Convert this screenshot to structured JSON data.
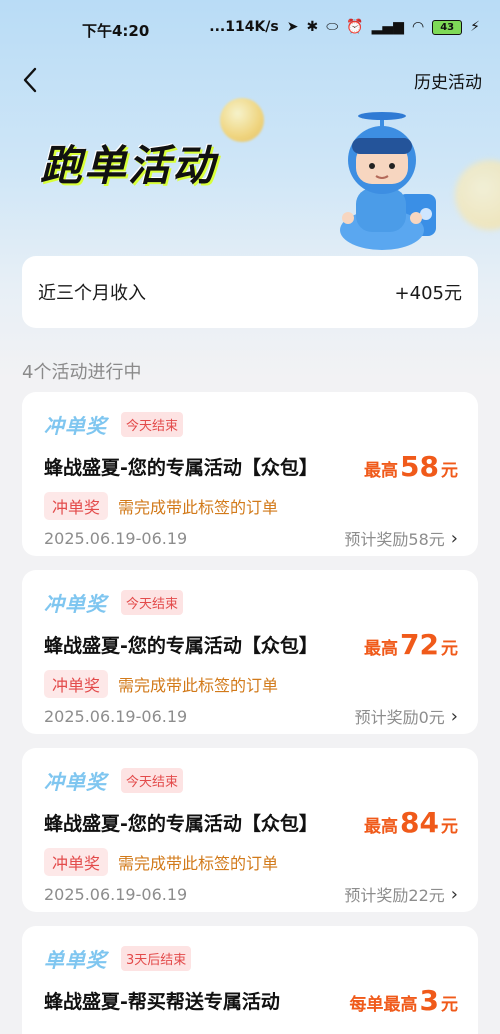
{
  "status": {
    "time": "下午4:20",
    "network": "...114K/s",
    "battery": "43"
  },
  "nav": {
    "back_icon": "chevron-left-icon",
    "history_label": "历史活动"
  },
  "hero": {
    "title": "跑单活动"
  },
  "income": {
    "label": "近三个月收入",
    "value": "+405元"
  },
  "section": {
    "title": "4个活动进行中"
  },
  "activities": [
    {
      "type_label": "冲单奖",
      "deadline": "今天结束",
      "title": "蜂战盛夏-您的专属活动【众包】",
      "reward_prefix": "最高",
      "reward_value": "58",
      "reward_unit": "元",
      "tag": "冲单奖",
      "requirement": "需完成带此标签的订单",
      "date_range": "2025.06.19-06.19",
      "estimate": "预计奖励58元"
    },
    {
      "type_label": "冲单奖",
      "deadline": "今天结束",
      "title": "蜂战盛夏-您的专属活动【众包】",
      "reward_prefix": "最高",
      "reward_value": "72",
      "reward_unit": "元",
      "tag": "冲单奖",
      "requirement": "需完成带此标签的订单",
      "date_range": "2025.06.19-06.19",
      "estimate": "预计奖励0元"
    },
    {
      "type_label": "冲单奖",
      "deadline": "今天结束",
      "title": "蜂战盛夏-您的专属活动【众包】",
      "reward_prefix": "最高",
      "reward_value": "84",
      "reward_unit": "元",
      "tag": "冲单奖",
      "requirement": "需完成带此标签的订单",
      "date_range": "2025.06.19-06.19",
      "estimate": "预计奖励22元"
    },
    {
      "type_label": "单单奖",
      "deadline": "3天后结束",
      "title": "蜂战盛夏-帮买帮送专属活动",
      "reward_prefix": "每单最高",
      "reward_value": "3",
      "reward_unit": "元"
    }
  ],
  "colors": {
    "accent": "#f05a1a",
    "type_label": "#7fc6f0",
    "deadline": "#e34b4b",
    "requirement": "#d27a1a"
  }
}
